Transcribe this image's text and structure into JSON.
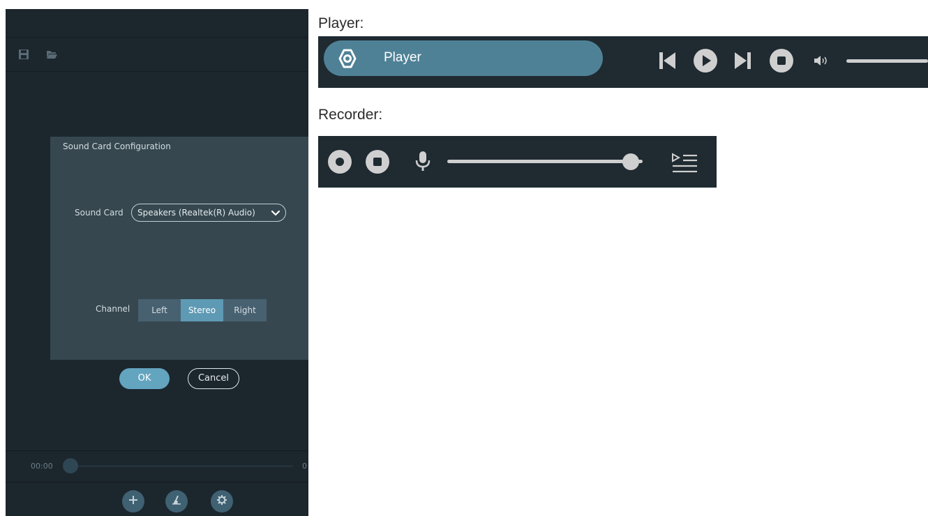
{
  "app": {
    "toolbar": {
      "save_icon": "save-icon",
      "open_icon": "folder-open-icon"
    },
    "dialog": {
      "title": "Sound Card Configuration",
      "sound_card_label": "Sound Card",
      "sound_card_value": "Speakers (Realtek(R) Audio)",
      "channel_label": "Channel",
      "channels": [
        "Left",
        "Stereo",
        "Right"
      ],
      "selected_channel": "Stereo",
      "ok_label": "OK",
      "cancel_label": "Cancel"
    },
    "timeline": {
      "current_time": "00:00",
      "end_time_partial": "0",
      "position": 0
    },
    "bottom_buttons": [
      "add-icon",
      "broom-icon",
      "gear-icon"
    ]
  },
  "showcase": {
    "player_caption": "Player:",
    "player_label": "Player",
    "recorder_caption": "Recorder:",
    "recorder_level": 0.94
  },
  "colors": {
    "accent": "#5f9ab4",
    "panel_bg": "#1c262d",
    "dialog_bg": "#36474f",
    "player_pill": "#4f8196",
    "control_icon": "#cfcfcf"
  }
}
